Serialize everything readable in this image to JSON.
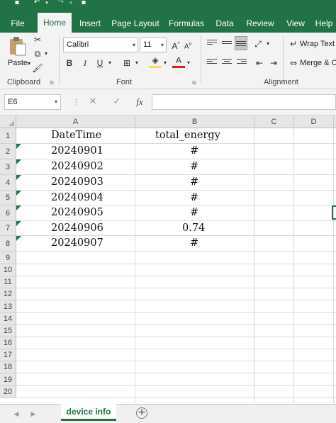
{
  "ribbon_tabs": [
    "File",
    "Home",
    "Insert",
    "Page Layout",
    "Formulas",
    "Data",
    "Review",
    "View",
    "Help"
  ],
  "active_tab": "Home",
  "clipboard": {
    "paste_label": "Paste",
    "group_label": "Clipboard"
  },
  "font": {
    "name": "Calibri",
    "size": "11",
    "group_label": "Font",
    "bold": "B",
    "italic": "I",
    "underline": "U",
    "grow": "A",
    "shrink": "A",
    "font_color_letter": "A"
  },
  "alignment": {
    "wrap_text": "Wrap Text",
    "merge_center": "Merge & C",
    "group_label": "Alignment"
  },
  "formula_bar": {
    "cell_ref": "E6",
    "fx": "fx",
    "content": ""
  },
  "columns": [
    "A",
    "B",
    "C",
    "D"
  ],
  "rows": [
    "1",
    "2",
    "3",
    "4",
    "5",
    "6",
    "7",
    "8",
    "9",
    "10",
    "11",
    "12",
    "13",
    "14",
    "15",
    "16",
    "17",
    "18",
    "19",
    "20"
  ],
  "cells": {
    "a1": "DateTime",
    "b1": "total_energy",
    "a2": "20240901",
    "b2": "#",
    "a3": "20240902",
    "b3": "#",
    "a4": "20240903",
    "b4": "#",
    "a5": "20240904",
    "b5": "#",
    "a6": "20240905",
    "b6": "#",
    "a7": "20240906",
    "b7": "0.74",
    "a8": "20240907",
    "b8": "#"
  },
  "sheet": {
    "name": "device info",
    "add": "+"
  },
  "colors": {
    "accent": "#217346",
    "ribbon_bg": "#f3f3f3",
    "header_bg": "#e6e6e6",
    "error_triangle": "#1e7a3e",
    "highlight_yellow": "#ffd966",
    "font_red": "#e02020"
  }
}
